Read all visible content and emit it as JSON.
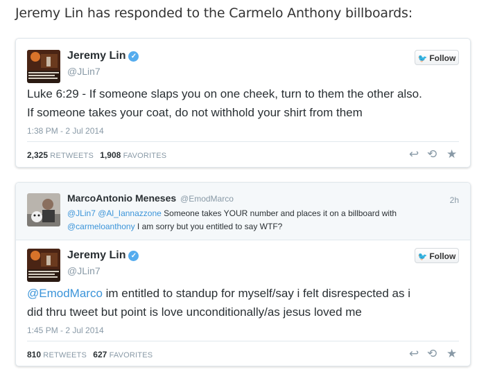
{
  "headline": "Jeremy Lin has responded to the Carmelo Anthony billboards:",
  "tweet1": {
    "name": "Jeremy Lin",
    "handle": "@JLin7",
    "follow_label": "Follow",
    "text_line1": "Luke 6:29 - If someone slaps you on one cheek, turn to them the other also.",
    "text_line2": "If someone takes your coat, do not withhold your shirt from them",
    "time": "1:38 PM - 2 Jul 2014",
    "retweets_count": "2,325",
    "retweets_label": "RETWEETS",
    "favorites_count": "1,908",
    "favorites_label": "FAVORITES"
  },
  "reply": {
    "name": "MarcoAntonio Meneses",
    "handle": "@EmodMarco",
    "time": "2h",
    "mention1": "@JLin7",
    "mention2": "@Al_Iannazzone",
    "text1": "Someone takes YOUR number and places it on a billboard with",
    "mention3": "@carmeloanthony",
    "text2": "I am sorry but you entitled to say WTF?"
  },
  "tweet2": {
    "name": "Jeremy Lin",
    "handle": "@JLin7",
    "follow_label": "Follow",
    "mention": "@EmodMarco",
    "text_line1": "im entitled to standup for myself/say i felt disrespected as i",
    "text_line2": "did thru tweet but point is love unconditionally/as jesus loved me",
    "time": "1:45 PM - 2 Jul 2014",
    "retweets_count": "810",
    "retweets_label": "RETWEETS",
    "favorites_count": "627",
    "favorites_label": "FAVORITES"
  },
  "icons": {
    "verified": "verified-badge-icon",
    "bird": "twitter-bird-icon",
    "reply": "reply-icon",
    "retweet": "retweet-icon",
    "favorite": "star-icon"
  },
  "colors": {
    "link": "#3b94d9",
    "verified": "#55acee",
    "muted": "#8899a6",
    "text": "#292f33"
  }
}
